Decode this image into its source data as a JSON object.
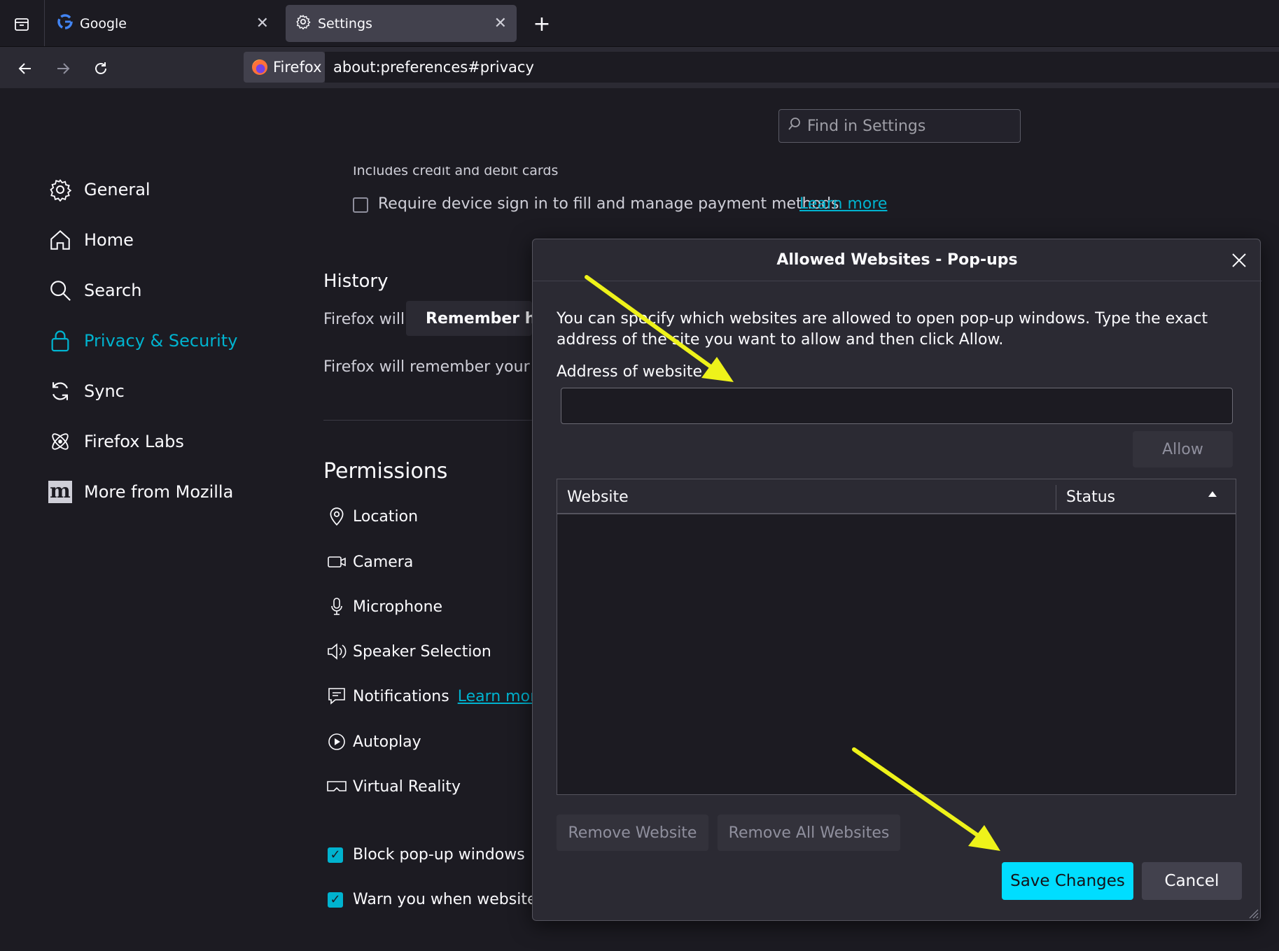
{
  "tabs": [
    {
      "label": "Google"
    },
    {
      "label": "Settings"
    }
  ],
  "toolbar": {
    "identity_label": "Firefox",
    "url": "about:preferences#privacy"
  },
  "settings": {
    "search_placeholder": "Find in Settings",
    "sidebar": [
      {
        "label": "General",
        "icon": "gear-icon"
      },
      {
        "label": "Home",
        "icon": "home-icon"
      },
      {
        "label": "Search",
        "icon": "magnifier-icon"
      },
      {
        "label": "Privacy & Security",
        "icon": "lock-icon",
        "active": true
      },
      {
        "label": "Sync",
        "icon": "sync-icon"
      },
      {
        "label": "Firefox Labs",
        "icon": "atom-icon"
      },
      {
        "label": "More from Mozilla",
        "icon": "mozilla-m-icon"
      }
    ],
    "cards_note": "Includes credit and debit cards",
    "require_signin_label": "Require device sign in to fill and manage payment methods",
    "learn_more": "Learn more",
    "history_heading": "History",
    "firefox_will": "Firefox will",
    "remember_history_label": "Remember history",
    "history_desc": "Firefox will remember your browsing",
    "permissions_heading": "Permissions",
    "permissions": [
      {
        "label": "Location",
        "icon": "location-pin-icon"
      },
      {
        "label": "Camera",
        "icon": "camera-icon"
      },
      {
        "label": "Microphone",
        "icon": "microphone-icon"
      },
      {
        "label": "Speaker Selection",
        "icon": "speaker-icon"
      },
      {
        "label": "Notifications",
        "icon": "notification-icon"
      },
      {
        "label": "Autoplay",
        "icon": "autoplay-icon"
      },
      {
        "label": "Virtual Reality",
        "icon": "vr-headset-icon"
      }
    ],
    "block_popups_label": "Block pop-up windows",
    "warn_label": "Warn you when websites try to install add-ons"
  },
  "dialog": {
    "title": "Allowed Websites - Pop-ups",
    "description": "You can specify which websites are allowed to open pop-up windows. Type the exact address of the site you want to allow and then click Allow.",
    "address_label": "Address of website",
    "address_value": "",
    "allow_button": "Allow",
    "columns": [
      "Website",
      "Status"
    ],
    "rows": [],
    "remove_website_button": "Remove Website",
    "remove_all_button": "Remove All Websites",
    "save_button": "Save Changes",
    "cancel_button": "Cancel"
  },
  "colors": {
    "accent": "#00b3cf",
    "primary_button": "#00ddff",
    "annotation_arrow": "#eef21a"
  }
}
